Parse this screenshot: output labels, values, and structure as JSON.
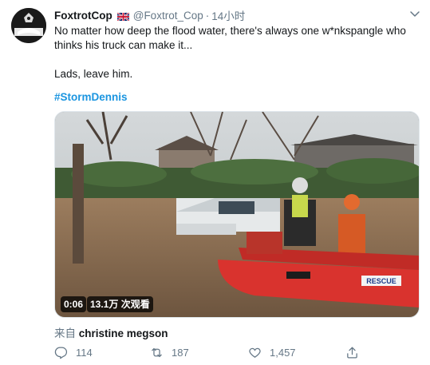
{
  "author": {
    "display_name": "FoxtrotCop",
    "handle": "@Foxtrot_Cop",
    "time": "14小时",
    "avatar_icon": "police-helmet-avatar",
    "flag_icon": "uk-flag-icon"
  },
  "tweet": {
    "text": "No matter how deep the flood water, there's always one w*nkspangle who thinks his truck can make it...\n\nLads, leave him.",
    "hashtag": "#StormDennis"
  },
  "media": {
    "duration": "0:06",
    "views": "13.1万 次观看",
    "boat_label": "RESCUE"
  },
  "source": {
    "prefix": "来自",
    "name": "christine megson"
  },
  "actions": {
    "replies": "114",
    "retweets": "187",
    "likes": "1,457"
  },
  "colors": {
    "link": "#1b95e0",
    "secondary_text": "#657786",
    "primary_text": "#14171a"
  }
}
